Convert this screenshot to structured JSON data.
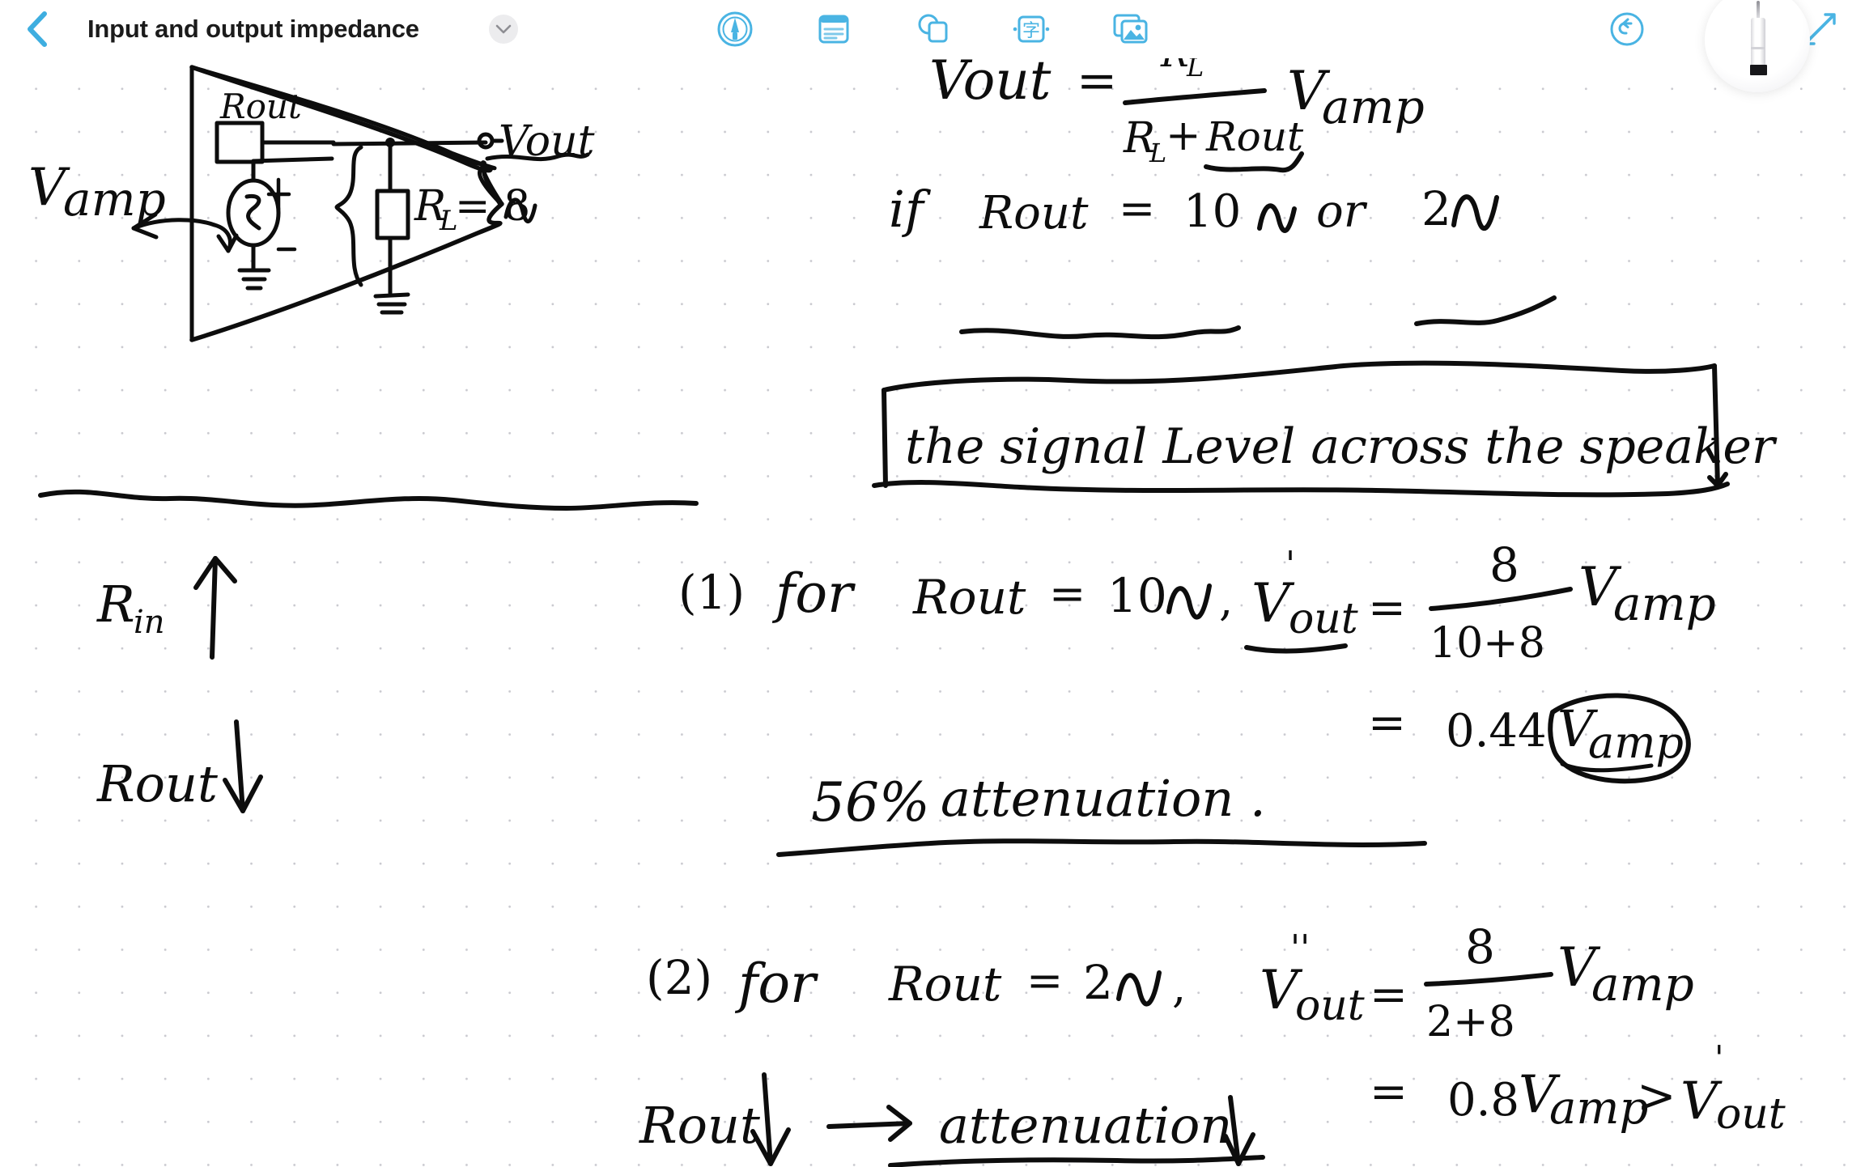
{
  "header": {
    "back_label": "Back",
    "title": "Input and output impedance",
    "title_chevron": "chevron-down",
    "tools": [
      {
        "id": "draw",
        "label": "Draw",
        "icon": "pen-circle-icon"
      },
      {
        "id": "note",
        "label": "Text note",
        "icon": "note-lines-icon"
      },
      {
        "id": "shape",
        "label": "Shapes",
        "icon": "shapes-icon"
      },
      {
        "id": "text",
        "label": "Text box",
        "icon": "text-box-icon",
        "glyph": "字"
      },
      {
        "id": "image",
        "label": "Insert image",
        "icon": "photo-stack-icon"
      }
    ],
    "actions": [
      {
        "id": "undo",
        "label": "Undo",
        "icon": "undo-icon"
      },
      {
        "id": "share",
        "label": "Share",
        "icon": "share-up-icon"
      },
      {
        "id": "edit",
        "label": "Edit",
        "icon": "edit-pencil-icon"
      }
    ],
    "stylus_tool": "stylus-indicator"
  },
  "notes": {
    "diagram": {
      "amplifier_label": "Vamp",
      "source_plus": "+",
      "source_minus": "-",
      "rout_label": "Rout",
      "output_label": "Vout",
      "load_label": "Rʟ = 8Ω",
      "load_value": "8",
      "load_unit": "Ω"
    },
    "equation_main": {
      "lhs": "Vout",
      "eq": "=",
      "numerator": "Rʟ",
      "denominator": "Rʟ + Rout",
      "multiplier": "Vamp",
      "full": "Vout = Rʟ / (Rʟ + Rout) · Vamp"
    },
    "condition_line": {
      "full": "if Rout = 10Ω or 2Ω",
      "if": "if",
      "rout": "Rout",
      "eq": "=",
      "value1": "10Ω",
      "or": "or",
      "value2": "2Ω"
    },
    "boxed_note": "the signal Level across the speaker",
    "left_column": [
      {
        "label": "Rin",
        "arrow": "up-arrow"
      },
      {
        "label": "Rout",
        "arrow": "down-arrow"
      }
    ],
    "case1": {
      "number": "(1)",
      "text": "for Rout = 10Ω,",
      "lhs": "V'out",
      "eq": "=",
      "numerator": "8",
      "denominator": "10+8",
      "multiplier": "Vamp",
      "result_eq": "=",
      "result": "0.44",
      "result_unit": "Vamp",
      "attenuation": "56% attenuation ."
    },
    "case2": {
      "number": "(2)",
      "text": "for Rout = 2Ω,",
      "lhs": "V''out",
      "eq": "=",
      "numerator": "8",
      "denominator": "2+8",
      "multiplier": "Vamp",
      "result_eq": "=",
      "result": "0.8 Vamp",
      "compare": "> V'out",
      "conclusion": "Rout ↓  →  attenuation ↓"
    }
  },
  "colors": {
    "accent": "#3eaee0",
    "ink": "#0d0d0d",
    "paper": "#ffffff",
    "grid_dot": "#c9c9cf",
    "title": "#1b1b1b"
  }
}
